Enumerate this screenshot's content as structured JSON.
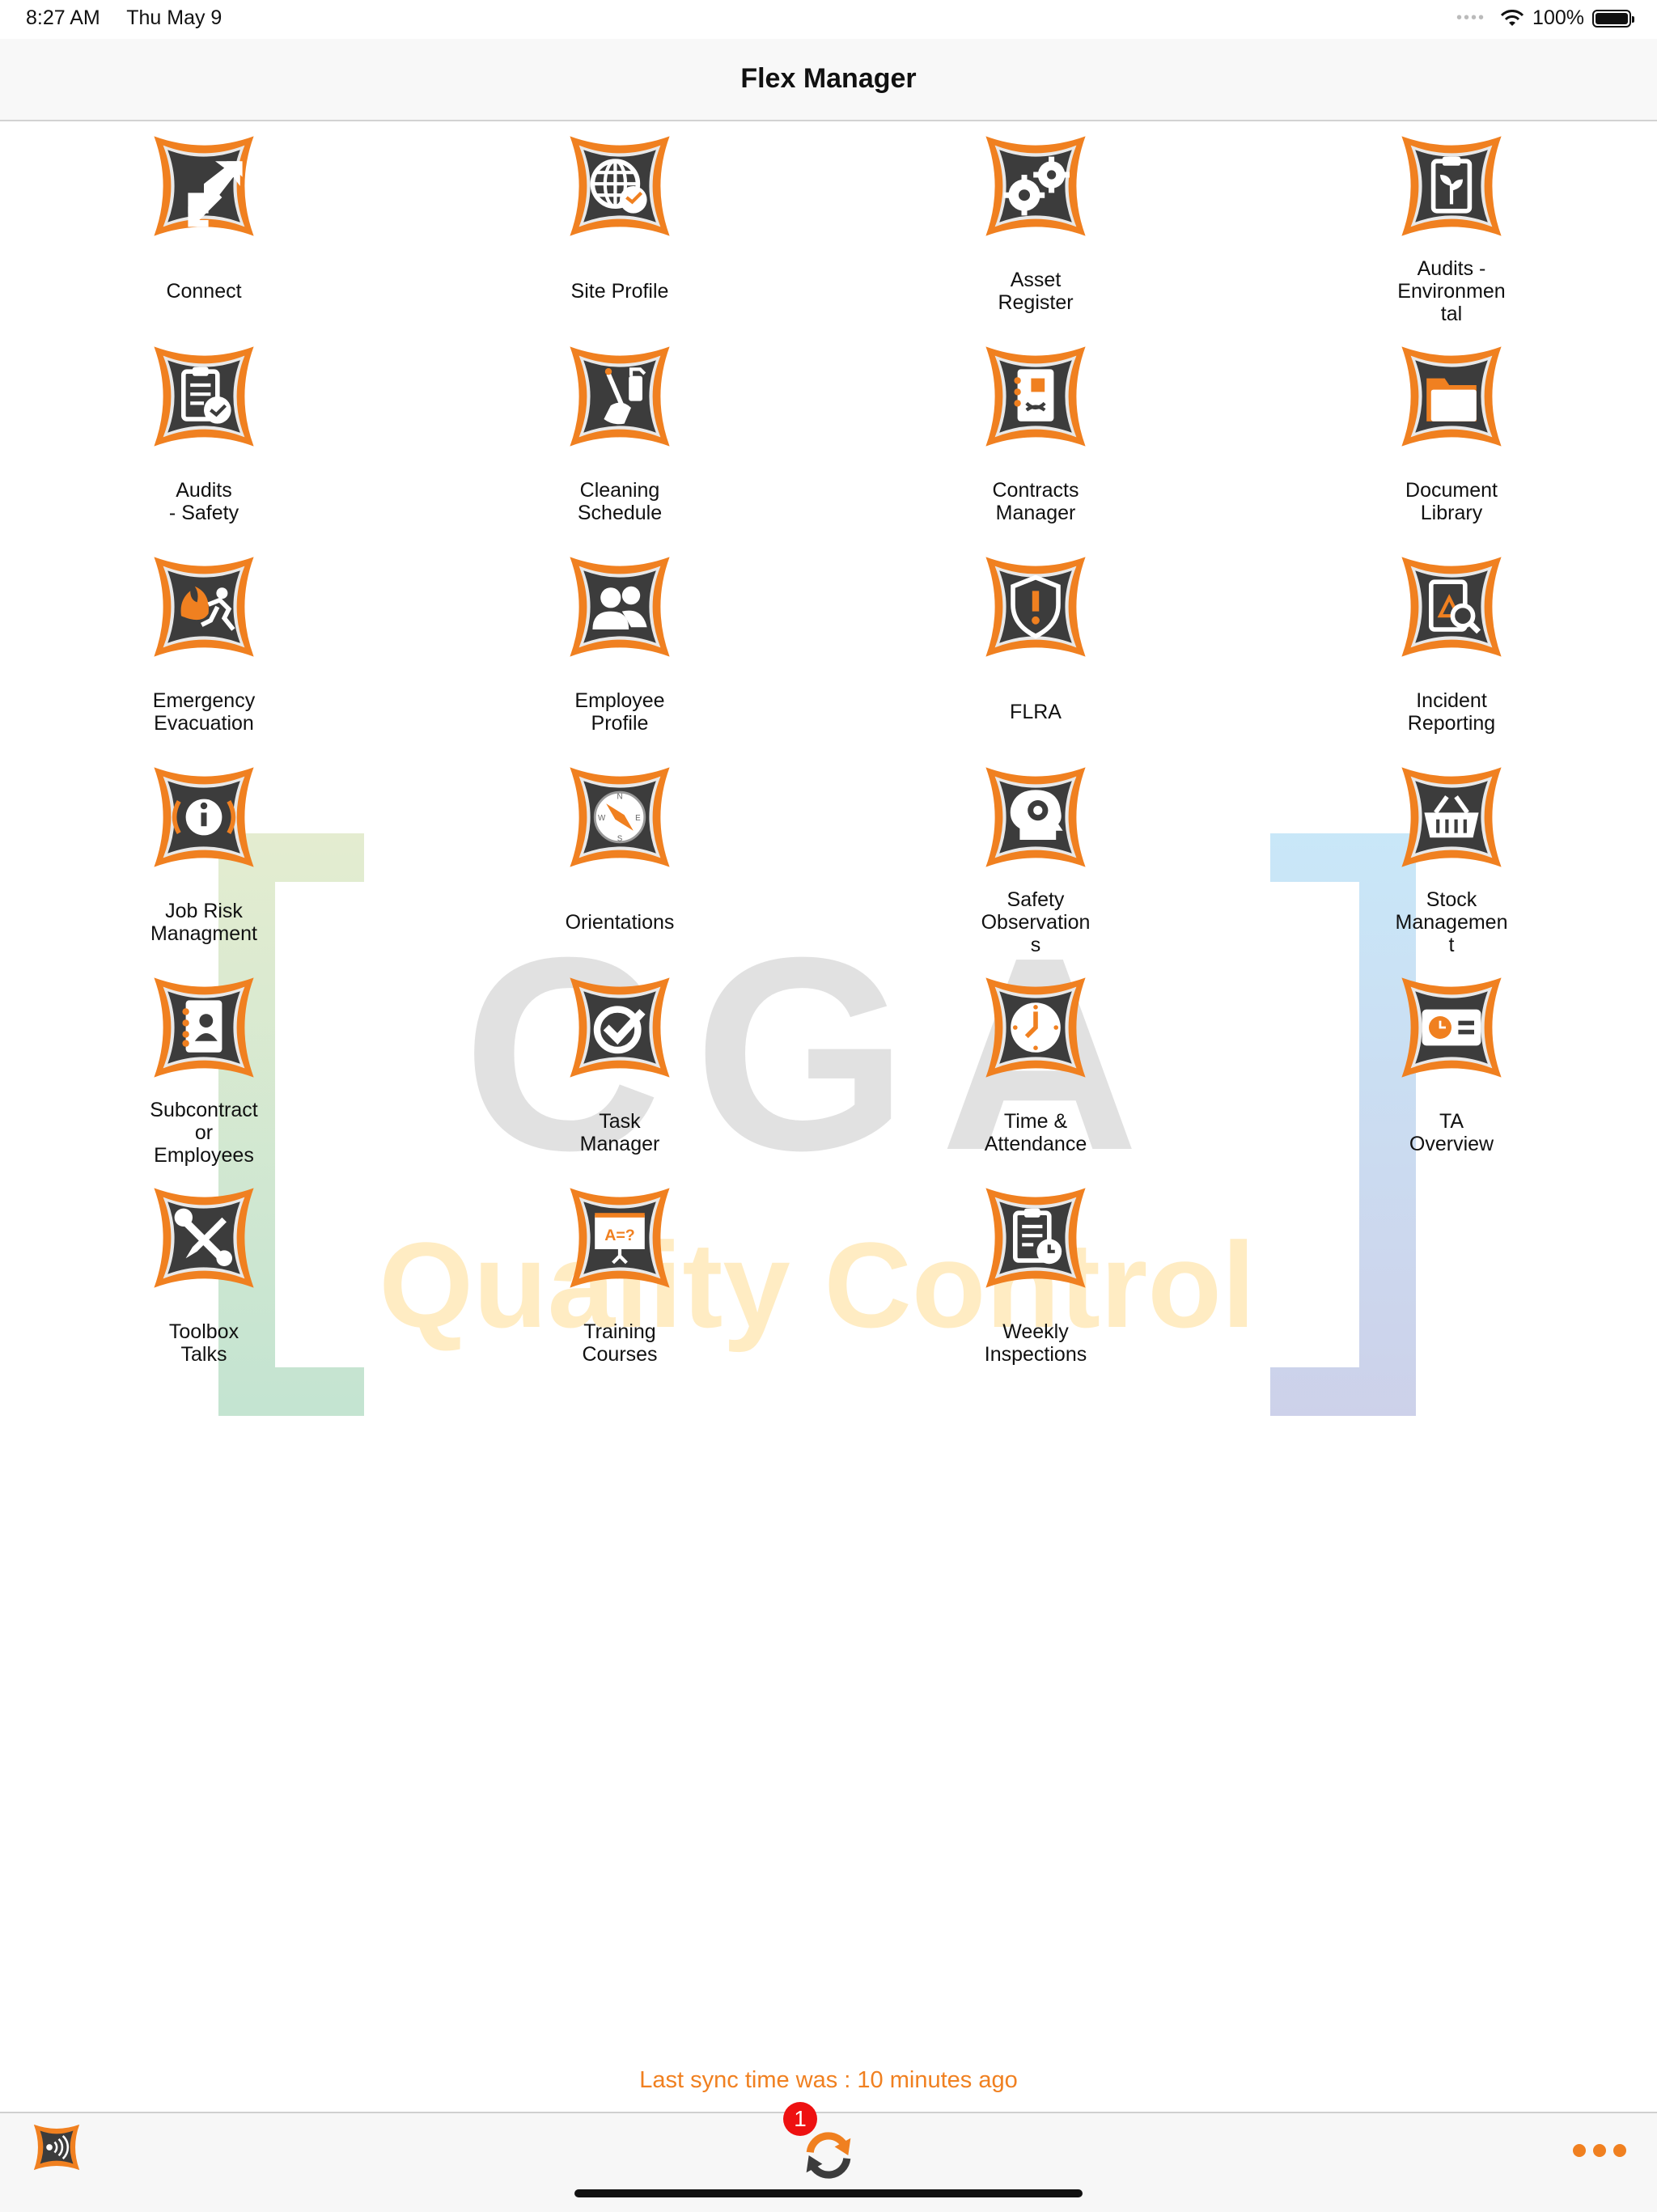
{
  "status_bar": {
    "time": "8:27 AM",
    "date": "Thu May 9",
    "battery": "100%",
    "battery_level": 1.0
  },
  "header": {
    "title": "Flex Manager"
  },
  "watermark": {
    "main_text": "CGA",
    "sub_text": "Quality Control"
  },
  "tiles": [
    {
      "label": "Connect",
      "icon": "connect-icon"
    },
    {
      "label": "Site Profile",
      "icon": "globe-icon"
    },
    {
      "label": "Asset\nRegister",
      "icon": "gears-icon"
    },
    {
      "label": "Audits -\nEnvironmen\ntal",
      "icon": "clipboard-plant-icon"
    },
    {
      "label": "Audits\n- Safety",
      "icon": "clipboard-check-icon"
    },
    {
      "label": "Cleaning\nSchedule",
      "icon": "cleaning-icon"
    },
    {
      "label": "Contracts\nManager",
      "icon": "contract-book-icon"
    },
    {
      "label": "Document\nLibrary",
      "icon": "folder-icon"
    },
    {
      "label": "Emergency\nEvacuation",
      "icon": "fire-exit-icon"
    },
    {
      "label": "Employee\nProfile",
      "icon": "people-icon"
    },
    {
      "label": "FLRA",
      "icon": "shield-alert-icon"
    },
    {
      "label": "Incident\nReporting",
      "icon": "incident-search-icon"
    },
    {
      "label": "Job Risk\nManagment",
      "icon": "info-icon"
    },
    {
      "label": "Orientations",
      "icon": "compass-icon"
    },
    {
      "label": "Safety\nObservation\ns",
      "icon": "head-gear-icon"
    },
    {
      "label": "Stock\nManagemen\nt",
      "icon": "basket-icon"
    },
    {
      "label": "Subcontract\nor\nEmployees",
      "icon": "contact-book-icon"
    },
    {
      "label": "Task\nManager",
      "icon": "check-circle-icon"
    },
    {
      "label": "Time &\nAttendance",
      "icon": "clock-icon"
    },
    {
      "label": "TA\nOverview",
      "icon": "timecard-icon"
    },
    {
      "label": "Toolbox\nTalks",
      "icon": "tools-icon"
    },
    {
      "label": "Training\nCourses",
      "icon": "presentation-icon"
    },
    {
      "label": "Weekly\nInspections",
      "icon": "clipboard-clock-icon"
    }
  ],
  "sync": {
    "text": "Last sync time was : 10 minutes ago",
    "badge_count": "1"
  },
  "colors": {
    "accent": "#f08020",
    "tile_dark": "#3c3c3c",
    "badge": "#ee1111"
  }
}
